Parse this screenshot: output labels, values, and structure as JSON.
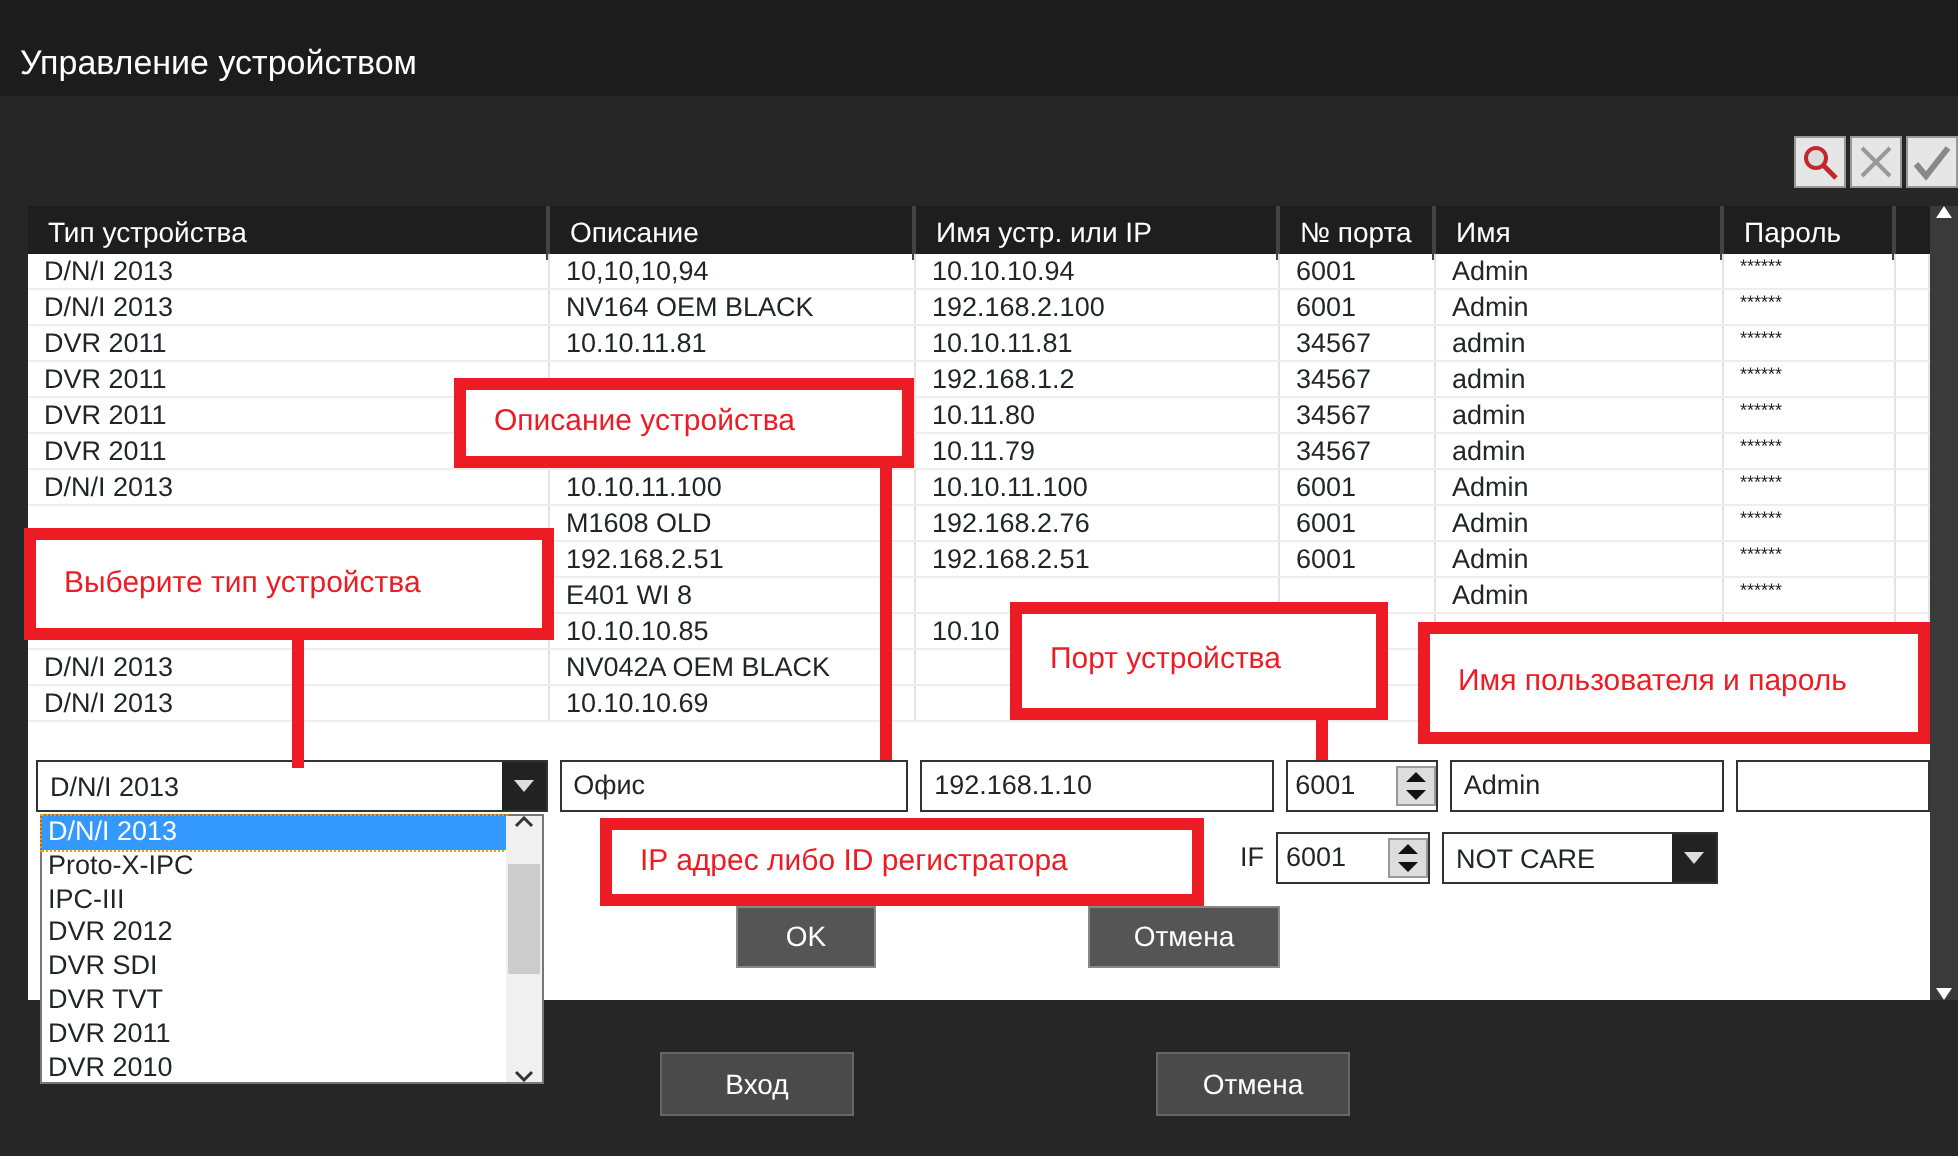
{
  "window": {
    "title": "Управление устройством"
  },
  "toolbar": {
    "buttons": [
      {
        "kind": "search"
      },
      {
        "kind": "delete"
      },
      {
        "kind": "confirm"
      }
    ]
  },
  "table": {
    "columns": [
      "Тип устройства",
      "Описание",
      "Имя устр. или IP",
      "№ порта",
      "Имя",
      "Пароль"
    ],
    "rows": [
      {
        "type": "D/N/I 2013",
        "description": "10,10,10,94",
        "address": "10.10.10.94",
        "port": "6001",
        "user": "Admin",
        "password": "******"
      },
      {
        "type": "D/N/I 2013",
        "description": "NV164 OEM BLACK",
        "address": "192.168.2.100",
        "port": "6001",
        "user": "Admin",
        "password": "******"
      },
      {
        "type": "DVR 2011",
        "description": "10.10.11.81",
        "address": "10.10.11.81",
        "port": "34567",
        "user": "admin",
        "password": "******"
      },
      {
        "type": "DVR 2011",
        "address": "192.168.1.2",
        "port": "34567",
        "user": "admin",
        "password": "******"
      },
      {
        "type": "DVR 2011",
        "address": "10.11.80",
        "port": "34567",
        "user": "admin",
        "password": "******"
      },
      {
        "type": "DVR 2011",
        "address": "10.11.79",
        "port": "34567",
        "user": "admin",
        "password": "******"
      },
      {
        "type": "D/N/I 2013",
        "description": "10.10.11.100",
        "address": "10.10.11.100",
        "port": "6001",
        "user": "Admin",
        "password": "******"
      },
      {
        "description": "M1608 OLD",
        "address": "192.168.2.76",
        "port": "6001",
        "user": "Admin",
        "password": "******"
      },
      {
        "description": "192.168.2.51",
        "address": "192.168.2.51",
        "port": "6001",
        "user": "Admin",
        "password": "******"
      },
      {
        "description": "E401 WI 8",
        "user": "Admin",
        "password": "******"
      },
      {
        "description": "10.10.10.85",
        "address": "10.10"
      },
      {
        "type": "D/N/I 2013",
        "description": "NV042A OEM BLACK"
      },
      {
        "type": "D/N/I 2013",
        "description": "10.10.10.69"
      }
    ]
  },
  "editor": {
    "device_type": "D/N/I 2013",
    "description": "Офис",
    "address": "192.168.1.10",
    "port": "6001",
    "user": "Admin",
    "protocol_label": "IF",
    "second_port": "6001",
    "mode": "NOT CARE",
    "ok": "OK",
    "cancel": "Отмена"
  },
  "dropdown": {
    "items": [
      {
        "label": "D/N/I 2013",
        "selected": true
      },
      {
        "label": "Proto-X-IPC",
        "selected": false
      },
      {
        "label": "IPC-III",
        "selected": false
      },
      {
        "label": "DVR 2012",
        "selected": false
      },
      {
        "label": "DVR SDI",
        "selected": false
      },
      {
        "label": "DVR TVT",
        "selected": false
      },
      {
        "label": "DVR 2011",
        "selected": false
      },
      {
        "label": "DVR 2010",
        "selected": false
      }
    ]
  },
  "footer": {
    "buttons": [
      "Вход",
      "Отмена"
    ]
  },
  "callouts": [
    {
      "text": "Выберите тип устройства"
    },
    {
      "text": "Описание устройства"
    },
    {
      "text": "Порт устройства"
    },
    {
      "text": "Имя пользователя и пароль"
    },
    {
      "text": "IP адрес либо ID регистратора"
    }
  ]
}
